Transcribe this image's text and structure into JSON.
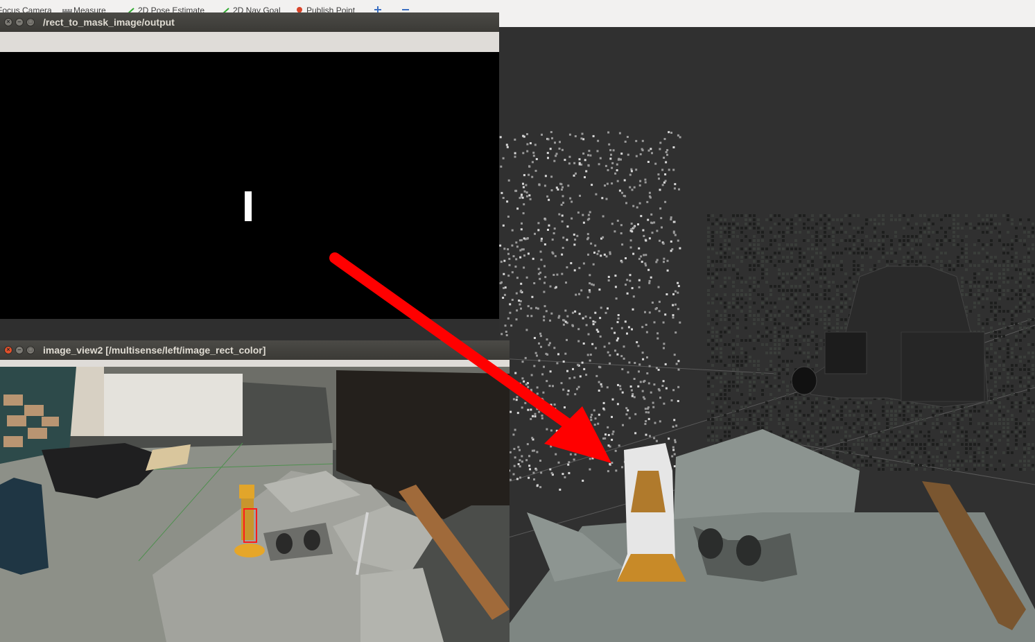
{
  "toolbar": {
    "items": [
      {
        "label": "Focus Camera",
        "icon": "focus-camera-icon"
      },
      {
        "label": "Measure",
        "icon": "ruler-icon"
      },
      {
        "label": "2D Pose Estimate",
        "icon": "pose-arrow-icon"
      },
      {
        "label": "2D Nav Goal",
        "icon": "nav-goal-icon"
      },
      {
        "label": "Publish Point",
        "icon": "map-pin-icon"
      }
    ]
  },
  "windows": {
    "mask": {
      "title": "/rect_to_mask_image/output"
    },
    "camera": {
      "title": "image_view2 [/multisense/left/image_rect_color]"
    }
  },
  "colors": {
    "arrow": "#ff0000",
    "titlebar": "#3f3e3a",
    "viewport_bg": "#303030",
    "mask_bg": "#000000",
    "mask_rect": "#ffffff",
    "bbox": "#ff0000"
  }
}
